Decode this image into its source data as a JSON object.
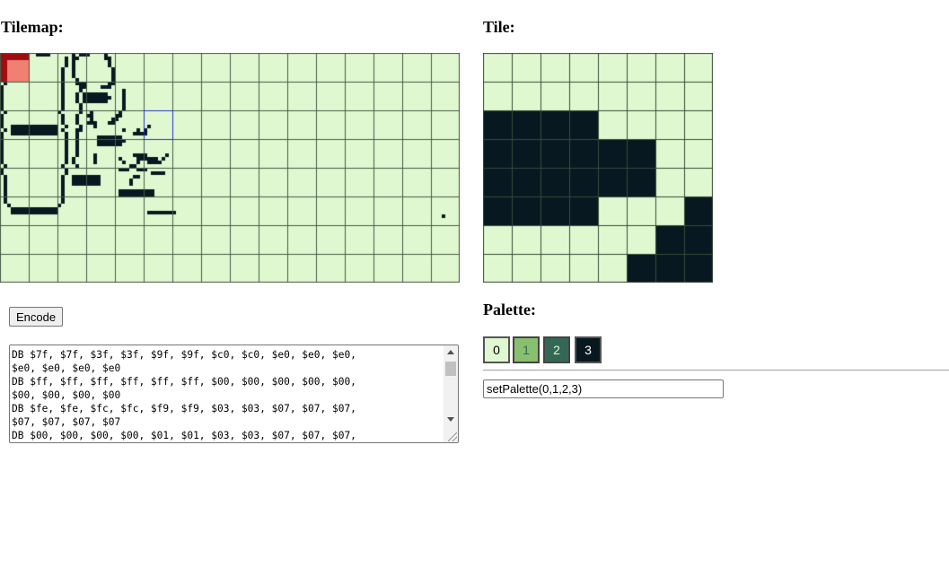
{
  "tilemap": {
    "heading": "Tilemap:",
    "cols": 16,
    "rows": 8,
    "rowsData": [
      "3333......3333......3.333....3..................................................................................................",
      "3.................3.33.......33..................................................................................................",
      "3.................3.3.........3.................................................................................................",
      "3.................3.3.........3.................................................................................................",
      "3................3..3..........3................................................................................................",
      "3................3..3..........3................................................................................................",
      ".3...............3..3..........3................................................................................................",
      ".3...............3...3.........3................................................................................................",
      ".3...............3...333......33................................................................................................",
      "3................3....33....333.................................................................................................",
      "3................3....3...........3.............................................................................................",
      "3................3...3.3333333....3.............................................................................................",
      "3................3...3.33333333...3.............................................................................................",
      "3................3...3.3333333....3.............................................................................................",
      "3................3....3...........3.............................................................................................",
      "3................3....3...........3.............................................................................................",
      ".3..............3.....3..3.......3..............................................................................................",
      "3................3...3..33......33..............................................................................................",
      "3................3...3...3.....33...............................................................................................",
      "3................3...3..333...33................................................................................................",
      "3..3333333333333..3...3...3..............3......................................................................................",
      ".3.3333333333333.3...33...........3...3.3.......................................................................................",
      "3..3333333333333..3..3...............3333.......................................................................................",
      "3.................3..3.....3333333..............................................................................................",
      "3.................3..3.....33333333.............................................................................................",
      "3.................3..3.....3333333..............................................................................................",
      "3.................3..3..........................................................................................................",
      "3.................3..3.........................................................................................................",
      "3.................3..3....3..........3333.....3.................................................................................",
      "3.................3.3.....3......3....333333.3..................................................................................",
      "3.................3.3.....3.......3...3..3333...................................................................................",
      ".3...............3...3..............33..........................................................................................",
      "3.................3..............333..333......................................................................................",
      "3.................3.......................3333.................................................................................",
      ".3...............3..33333333.........33...........................................................................................",
      ".3...............3..33333333........3.............................................................................................",
      ".3...............3..33333333........3.............................................................................................",
      ".3...............3................................................................................................................",
      ".3...............3...............3333333333.....................................................................................",
      ".3...............3...............3333333333.....................................................................................",
      ".3...............3..............................................................................................................",
      ".3...............3..............................................................................................................",
      "..3.............3...............................................................................................................",
      "...3333333333333.......................................................................................................................",
      "...3333333333333.........................33333333...............................................................................",
      "...........................................................................................................................3....",
      "................................................................................................................................",
      "................................................................................................................................",
      "................................................................................................................................",
      "................................................................................................................................",
      "................................................................................................................................",
      "................................................................................................................................",
      "................................................................................................................................",
      "................................................................................................................................",
      "................................................................................................................................",
      "................................................................................................................................",
      "................................................................................................................................",
      "................................................................................................................................",
      "................................................................................................................................",
      "................................................................................................................................",
      "................................................................................................................................",
      "................................................................................................................................",
      "................................................................................................................................",
      "................................................................................................................................"
    ],
    "highlight": {
      "cell_col": 0,
      "cell_row": 0,
      "dark_color": "#a00c10",
      "light_color": "#f08070"
    },
    "selection": {
      "col": 5,
      "row": 2,
      "color": "#2030c0"
    },
    "grid_color": "#4a5a48"
  },
  "tile": {
    "heading": "Tile:",
    "pixels": [
      "00000000",
      "00000000",
      "33330000",
      "33333300",
      "33333300",
      "33330003",
      "00000033",
      "00000333"
    ]
  },
  "palette": {
    "heading": "Palette:",
    "buttons": [
      "0",
      "1",
      "2",
      "3"
    ],
    "colors": [
      "#e0f8d0",
      "#88c070",
      "#346856",
      "#081820"
    ]
  },
  "controls": {
    "encode_label": "Encode",
    "command_value": "setPalette(0,1,2,3)"
  },
  "output": {
    "text": "DB $7f, $7f, $3f, $3f, $9f, $9f, $c0, $c0, $e0, $e0, $e0,\n$e0, $e0, $e0, $e0\nDB $ff, $ff, $ff, $ff, $ff, $ff, $00, $00, $00, $00, $00,\n$00, $00, $00, $00\nDB $fe, $fe, $fc, $fc, $f9, $f9, $03, $03, $07, $07, $07,\n$07, $07, $07, $07\nDB $00, $00, $00, $00, $01, $01, $03, $03, $07, $07, $07,"
  }
}
